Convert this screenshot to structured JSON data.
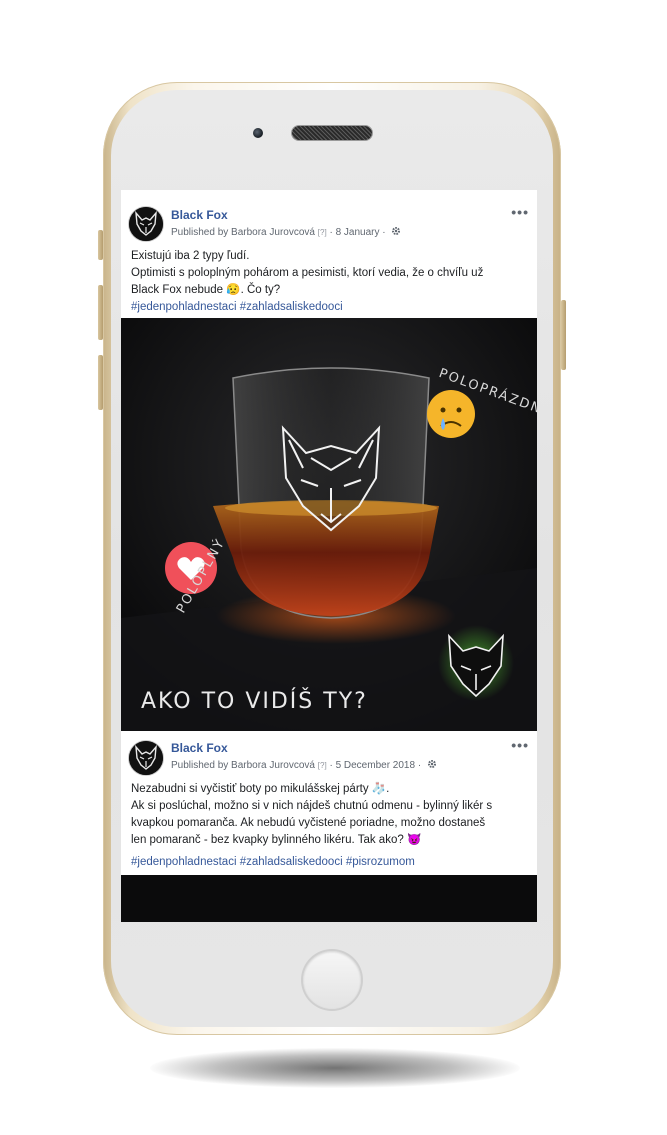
{
  "posts": [
    {
      "page_name": "Black Fox",
      "published_by": "Published by Barbora Jurovcová",
      "help_marker": "[?]",
      "date": "8 January",
      "lines": [
        "Existujú iba 2 typy ľudí.",
        "Optimisti s poloplným pohárom a pesimisti, ktorí vedia, že o chvíľu už",
        "Black Fox nebude 😥. Čo ty?"
      ],
      "hashtags": "#jedenpohladnestaci #zahladsaliskedooci",
      "image": {
        "caption": "AKO TO VIDÍŠ TY?",
        "label_full": "POLOPLNÝ",
        "label_empty": "POLOPRÁZDNY"
      }
    },
    {
      "page_name": "Black Fox",
      "published_by": "Published by Barbora Jurovcová",
      "help_marker": "[?]",
      "date": "5 December 2018",
      "lines": [
        "Nezabudni si vyčistiť boty po mikulášskej párty 🧦.",
        "Ak si poslúchal, možno si v nich nájdeš chutnú odmenu - bylinný likér s",
        "kvapkou pomaranča. Ak nebudú vyčistené poriadne, možno dostaneš",
        "len pomaranč - bez kvapky bylinného likéru. Tak ako? 😈"
      ],
      "hashtags": "#jedenpohladnestaci #zahladsaliskedooci #pisrozumom"
    }
  ],
  "icons": {
    "more": "more-dots-icon",
    "audience": "gear-icon",
    "sad_emoji": "sad-emoji-icon",
    "heart": "heart-icon"
  },
  "colors": {
    "link": "#365899",
    "text": "#1c1e21",
    "meta": "#606770",
    "phone_gold": "#e7d6b2",
    "sad_emoji": "#f5b52a",
    "heart_bg": "#f0505a",
    "glow": "#6cff3c"
  }
}
